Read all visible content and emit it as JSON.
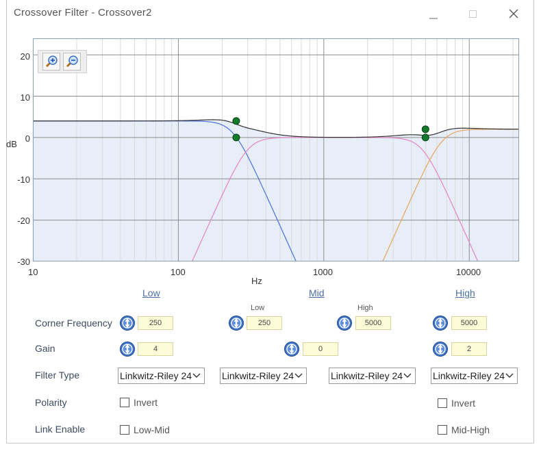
{
  "window": {
    "title": "Crossover Filter - Crossover2"
  },
  "chart_data": {
    "type": "line",
    "xscale": "log",
    "xlim": [
      10,
      22000
    ],
    "ylim": [
      -30,
      24
    ],
    "xlabel": "Hz",
    "ylabel": "dB",
    "y_ticks": [
      "20",
      "10",
      "0",
      "-10",
      "-20",
      "-30"
    ],
    "x_ticks": [
      "10",
      "100",
      "1000",
      "10000"
    ],
    "grid": true,
    "handles": [
      {
        "x": 250,
        "y": 4
      },
      {
        "x": 250,
        "y": 0
      },
      {
        "x": 5000,
        "y": 2
      },
      {
        "x": 5000,
        "y": 0
      }
    ],
    "colors": {
      "low": "#5577dd",
      "mid": "#e58ac4",
      "high": "#e8a868",
      "sum": "#333333",
      "fill": "#e6edf8"
    }
  },
  "bands": {
    "low": "Low",
    "mid": "Mid",
    "high": "High"
  },
  "rows": {
    "corner_frequency": "Corner Frequency",
    "gain": "Gain",
    "filter_type": "Filter Type",
    "polarity": "Polarity",
    "link_enable": "Link Enable"
  },
  "mid_sub": {
    "low": "Low",
    "high": "High"
  },
  "values": {
    "low_freq": "250",
    "mid_low_freq": "250",
    "mid_high_freq": "5000",
    "high_freq": "5000",
    "low_gain": "4",
    "mid_gain": "0",
    "high_gain": "2"
  },
  "filter_types": {
    "low": "Linkwitz-Riley 24",
    "mid_low": "Linkwitz-Riley 24",
    "mid_high": "Linkwitz-Riley 24",
    "high": "Linkwitz-Riley 24"
  },
  "checkboxes": {
    "low_invert": "Invert",
    "high_invert": "Invert",
    "link_low_mid": "Low-Mid",
    "link_mid_high": "Mid-High"
  }
}
